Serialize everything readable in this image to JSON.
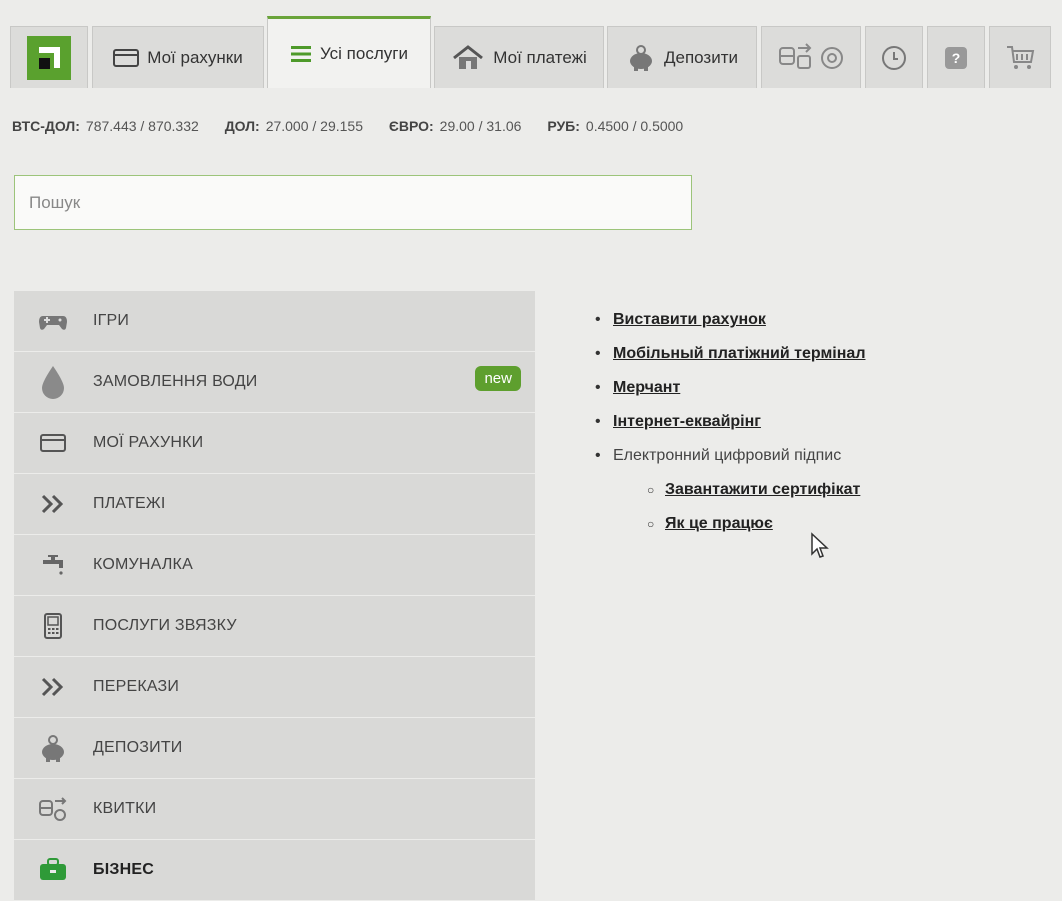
{
  "tabs": [
    {
      "label": "Мої рахунки",
      "icon": "card-icon",
      "active": false
    },
    {
      "label": "Усі послуги",
      "icon": "list-icon",
      "active": true
    },
    {
      "label": "Мої платежі",
      "icon": "house-icon",
      "active": false
    },
    {
      "label": "Депозити",
      "icon": "piggy-bank-icon",
      "active": false
    }
  ],
  "rates": [
    {
      "code": "ВТС-ДОЛ:",
      "value": "787.443 / 870.332"
    },
    {
      "code": "ДОЛ:",
      "value": "27.000 / 29.155"
    },
    {
      "code": "ЄВРО:",
      "value": "29.00 / 31.06"
    },
    {
      "code": "РУБ:",
      "value": "0.4500 / 0.5000"
    }
  ],
  "search": {
    "placeholder": "Пошук"
  },
  "categories": [
    {
      "name": "ІГРИ",
      "icon": "gamepad-icon"
    },
    {
      "name": "ЗАМОВЛЕННЯ ВОДИ",
      "icon": "water-drop-icon",
      "badge": "new"
    },
    {
      "name": "МОЇ РАХУНКИ",
      "icon": "card-icon"
    },
    {
      "name": "ПЛАТЕЖІ",
      "icon": "chevrons-icon"
    },
    {
      "name": "КОМУНАЛКА",
      "icon": "faucet-icon"
    },
    {
      "name": "ПОСЛУГИ ЗВЯЗКУ",
      "icon": "phone-icon"
    },
    {
      "name": "ПЕРЕКАЗИ",
      "icon": "chevrons-icon"
    },
    {
      "name": "ДЕПОЗИТИ",
      "icon": "piggy-bank-icon"
    },
    {
      "name": "КВИТКИ",
      "icon": "tickets-icon"
    },
    {
      "name": "БІЗНЕС",
      "icon": "briefcase-icon",
      "active": true
    }
  ],
  "links": {
    "invoice": "Виставити рахунок",
    "mobile_terminal": "Мобільный платіжний термінал",
    "merchant": "Мерчант",
    "acquiring": "Інтернет-еквайрінг",
    "signature": "Електронний цифровий підпис",
    "download_cert": "Завантажити сертифікат",
    "how_it_works": "Як це працює"
  },
  "colors": {
    "accent": "#5e9f2e",
    "panel": "#d9d9d7",
    "background": "#ececea"
  }
}
